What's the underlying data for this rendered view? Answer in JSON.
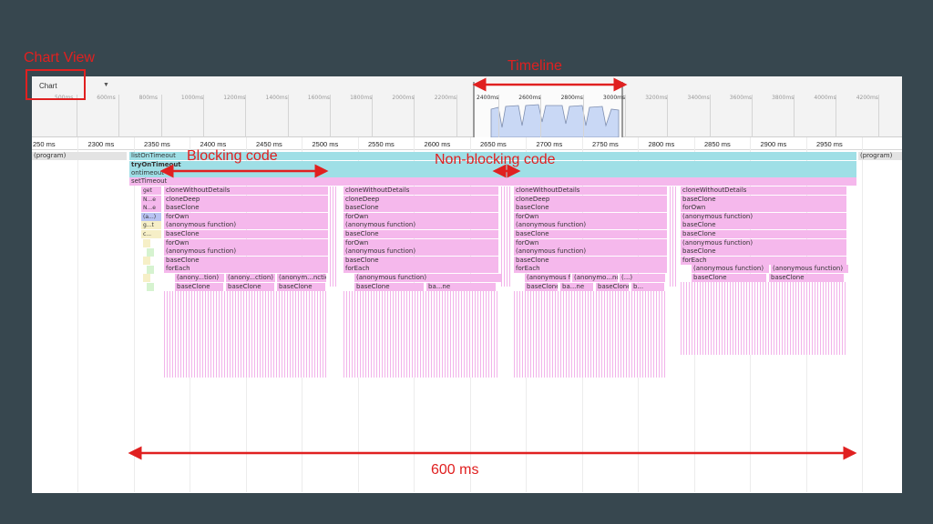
{
  "annotations": {
    "chart_view": "Chart View",
    "timeline": "Timeline",
    "blocking": "Blocking code",
    "non_blocking": "Non-blocking code",
    "duration": "600 ms"
  },
  "colors": {
    "annotation": "#e02020",
    "cyan": "#9fdfe6",
    "pink": "#f5b8ec"
  },
  "toolbar": {
    "view_select": "Chart",
    "dropdown_icon": "chevron-down-icon"
  },
  "overview": {
    "labels": [
      "500ms",
      "600ms",
      "800ms",
      "1000ms",
      "1200ms",
      "1400ms",
      "1600ms",
      "1800ms",
      "2000ms",
      "2200ms",
      "2400ms",
      "2600ms",
      "2800ms",
      "3000ms",
      "3200ms",
      "3400ms",
      "3600ms",
      "3800ms",
      "4000ms",
      "4200ms"
    ]
  },
  "ruler": {
    "labels": [
      "250 ms",
      "2300 ms",
      "2350 ms",
      "2400 ms",
      "2450 ms",
      "2500 ms",
      "2550 ms",
      "2600 ms",
      "2650 ms",
      "2700 ms",
      "2750 ms",
      "2800 ms",
      "2850 ms",
      "2900 ms",
      "2950 ms"
    ]
  },
  "rows": {
    "program_left": "(program)",
    "program_right": "(program)",
    "listOnTimeout": "listOnTimeout",
    "tryOnTimeout": "tryOnTimeout",
    "ontimeout": "ontimeout",
    "setTimeout": "setTimeout",
    "mini": [
      "get",
      "N...e",
      "N...e",
      "(a...)",
      "g...t",
      "c..."
    ]
  },
  "stacks": [
    {
      "labels": [
        "cloneWithoutDetails",
        "cloneDeep",
        "baseClone",
        "forOwn",
        "(anonymous function)",
        "baseClone",
        "forOwn",
        "(anonymous function)",
        "baseClone",
        "forEach"
      ],
      "bottom": [
        "(anony...tion)",
        "(anony...ction)",
        "(anonym...nction)"
      ],
      "base": [
        "baseClone",
        "baseClone",
        "baseClone"
      ]
    },
    {
      "labels": [
        "cloneWithoutDetails",
        "cloneDeep",
        "baseClone",
        "forOwn",
        "(anonymous function)",
        "baseClone",
        "forOwn",
        "(anonymous function)",
        "baseClone",
        "forEach"
      ],
      "bottom": [
        "(anonymous function)"
      ],
      "base": [
        "baseClone",
        "ba...ne"
      ]
    },
    {
      "labels": [
        "cloneWithoutDetails",
        "cloneDeep",
        "baseClone",
        "forOwn",
        "(anonymous function)",
        "baseClone",
        "forOwn",
        "(anonymous function)",
        "baseClone",
        "forEach"
      ],
      "bottom": [
        "(anonymous function)",
        "(anonymo...nction)",
        "(...)"
      ],
      "base": [
        "baseClone",
        "ba...ne",
        "baseClone",
        "b..."
      ]
    },
    {
      "labels": [
        "cloneWithoutDetails",
        "baseClone",
        "forOwn",
        "(anonymous function)",
        "baseClone",
        "baseClone",
        "(anonymous function)",
        "baseClone",
        "forEach"
      ],
      "bottom": [
        "(anonymous function)",
        "(anonymous function)"
      ],
      "base": [
        "baseClone",
        "baseClone"
      ]
    }
  ]
}
